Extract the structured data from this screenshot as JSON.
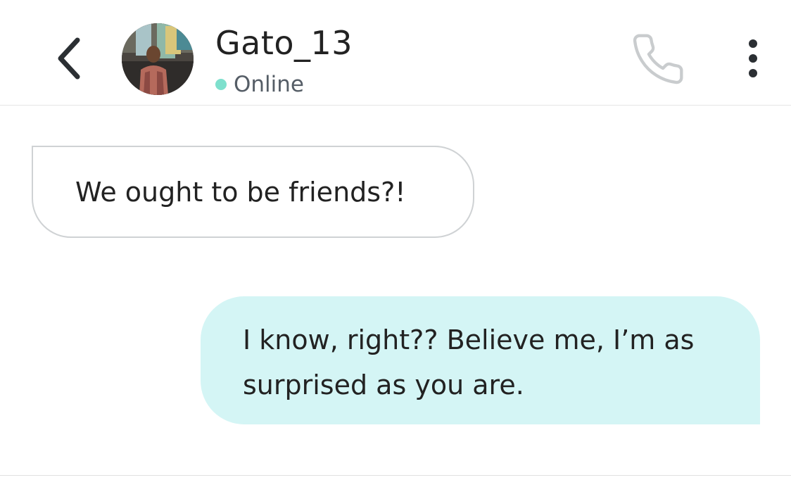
{
  "header": {
    "back_icon": "chevron-left-icon",
    "avatar_alt": "contact-avatar",
    "contact_name": "Gato_13",
    "status_text": "Online",
    "status_color": "#7ee0cd",
    "call_icon": "phone-icon",
    "more_icon": "vertical-dots-icon"
  },
  "messages": [
    {
      "direction": "incoming",
      "text": "We ought to be friends?!"
    },
    {
      "direction": "outgoing",
      "text": "I know, right?? Believe me, I’m as surprised as you are.",
      "bubble_color": "#d4f5f5"
    }
  ]
}
